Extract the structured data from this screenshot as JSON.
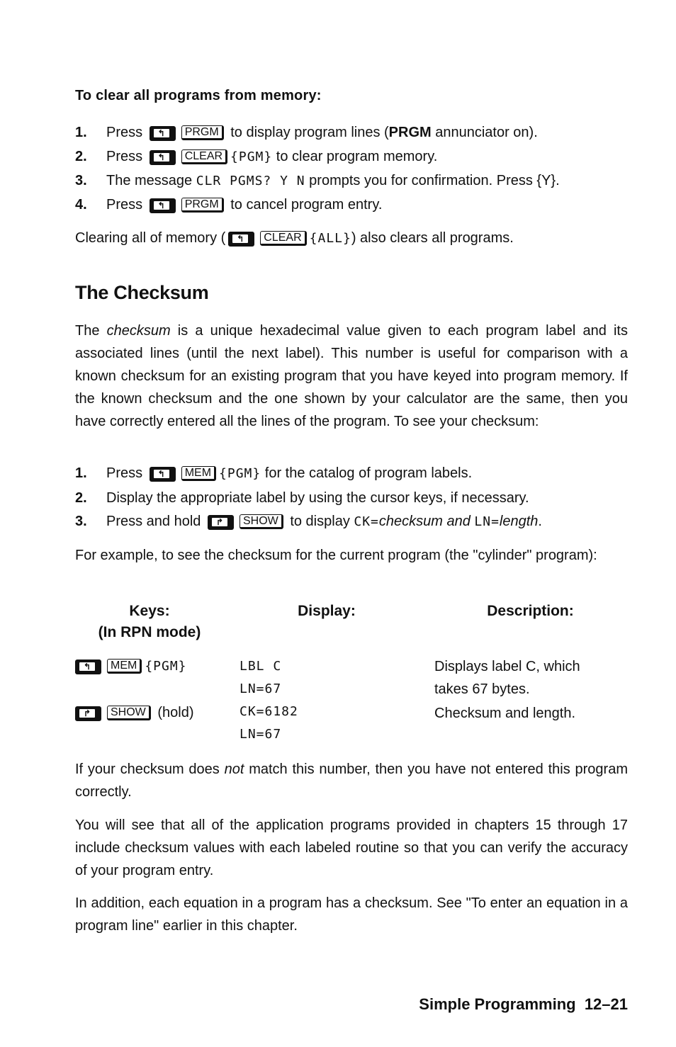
{
  "procedure_clear": {
    "heading": "To clear all programs from memory:",
    "steps": [
      {
        "num": "1.",
        "pre": "Press",
        "shift": "left-shift",
        "key": "PRGM",
        "post_a": " to display program lines (",
        "bold": "PRGM",
        "post_b": " annunciator on)."
      },
      {
        "num": "2.",
        "pre": "Press",
        "shift": "left-shift",
        "key": "CLEAR",
        "menu": "{PGM}",
        "post": " to clear program memory."
      },
      {
        "num": "3.",
        "pre": "The message ",
        "lcd": "CLR PGMS? Y N",
        "post": " prompts you for confirmation. Press {Y}."
      },
      {
        "num": "4.",
        "pre": "Press",
        "shift": "left-shift",
        "key": "PRGM",
        "post": " to cancel program entry."
      }
    ],
    "note_pre": "Clearing all of memory (",
    "note_key": "CLEAR",
    "note_menu": "{ALL}",
    "note_post": ") also clears all programs."
  },
  "section": {
    "title": "The Checksum",
    "intro_pre": "The ",
    "intro_italic": "checksum",
    "intro_post": " is a unique hexadecimal value given to each program label and its associated lines (until the next label). This number is useful for comparison with a known checksum for an existing program that you have keyed into program memory. If the known checksum and the one shown by your calculator are the same, then you have correctly entered all the lines of the program. To see your checksum:",
    "steps": [
      {
        "num": "1.",
        "pre": "Press",
        "key": "MEM",
        "menu": "{PGM}",
        "post": " for the catalog of program labels."
      },
      {
        "num": "2.",
        "text": "Display the appropriate label by using the cursor keys, if necessary."
      },
      {
        "num": "3.",
        "pre": "Press and hold",
        "key": "SHOW",
        "post_a": " to display ",
        "lcd1": "CK=",
        "it1": "checksum and ",
        "lcd2": "LN=",
        "it2": "length",
        "post_b": "."
      }
    ],
    "example": "For example, to see the checksum for the current program (the \"cylinder\" program):"
  },
  "table": {
    "headers": {
      "keys_1": "Keys:",
      "keys_2": "(In RPN mode)",
      "display": "Display:",
      "description": "Description:"
    },
    "rows": [
      {
        "key": "MEM",
        "menu": "{PGM}",
        "display_1": "LBL C",
        "display_2": "LN=67",
        "desc_1": "Displays label C, which",
        "desc_2": "takes 67 bytes."
      },
      {
        "key": "SHOW",
        "suffix": "(hold)",
        "display_1": "CK=6182",
        "display_2": "LN=67",
        "desc_1": "Checksum and length."
      }
    ]
  },
  "after": {
    "p1_pre": "If your checksum does ",
    "p1_it": "not",
    "p1_post": " match this number, then you have not entered this program correctly.",
    "p2": "You will see that all of the application programs provided in chapters 15 through 17 include checksum values with each labeled routine so that you can verify the accuracy of your program entry.",
    "p3": "In addition, each equation in a program has a checksum. See \"To enter an equation in a program line\" earlier in this chapter."
  },
  "footer": {
    "chapter": "Simple Programming",
    "page": "12–21"
  }
}
